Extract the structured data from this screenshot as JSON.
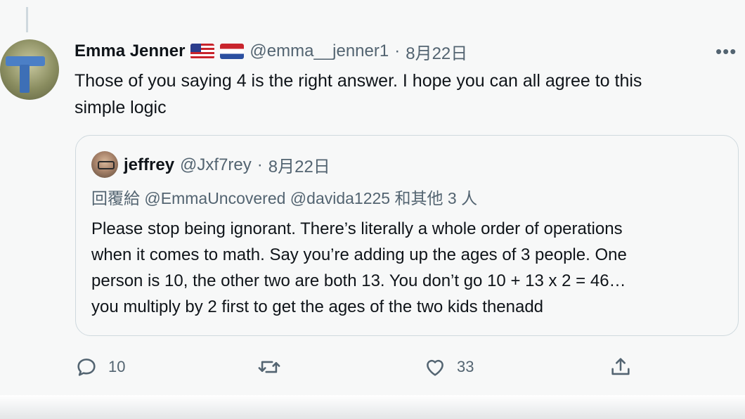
{
  "tweet": {
    "author_name": "Emma Jenner",
    "flags": [
      "us-flag",
      "netherlands-flag"
    ],
    "handle": "@emma__jenner1",
    "separator": "·",
    "date": "8月22日",
    "more_icon": "more-icon",
    "text_line1": "Those of you saying 4 is the right answer. I hope you can all agree to this",
    "text_line2": "simple logic"
  },
  "quote": {
    "author_name": "jeffrey",
    "handle": "@Jxf7rey",
    "separator": "·",
    "date": "8月22日",
    "reply_prefix": "回覆給",
    "reply_mentions": "@EmmaUncovered @davida1225",
    "reply_suffix": "和其他 3 人",
    "lines": [
      "Please stop being ignorant. There’s literally a whole order of operations",
      "when it comes to math. Say you’re adding up the ages of 3 people. One",
      "person is 10, the other two are both 13. You don’t go 10 + 13 x 2 = 46…",
      "you multiply by 2 first to get the ages of the two kids thenadd"
    ]
  },
  "actions": {
    "reply_icon": "reply-icon",
    "reply_count": "10",
    "retweet_icon": "retweet-icon",
    "like_icon": "heart-icon",
    "like_count": "33",
    "share_icon": "share-icon"
  },
  "colors": {
    "text": "#0f1419",
    "muted": "#536471",
    "border": "#cfd9de",
    "background": "#f7f8f8"
  }
}
